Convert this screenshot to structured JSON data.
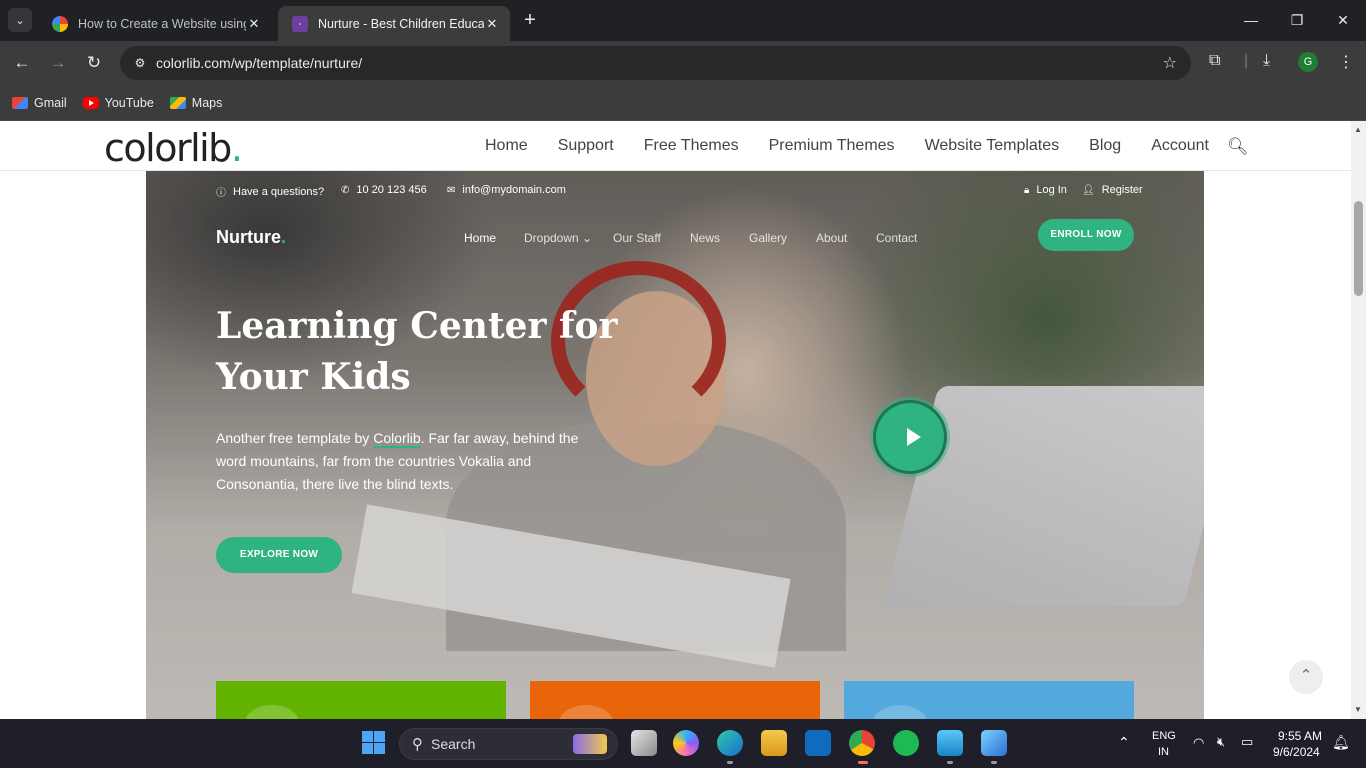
{
  "browser": {
    "tab_list_icon": "chevron-down-icon",
    "tabs": [
      {
        "title": "How to Create a Website using",
        "favicon": "google-icon"
      },
      {
        "title": "Nurture - Best Children Educati",
        "favicon": "colorlib-icon"
      }
    ],
    "new_tab": "+",
    "window": {
      "minimize": "—",
      "maximize": "❐",
      "close": "✕"
    },
    "url": "colorlib.com/wp/template/nurture/",
    "bookmarks": [
      {
        "label": "Gmail",
        "icon": "gmail-icon"
      },
      {
        "label": "YouTube",
        "icon": "youtube-icon"
      },
      {
        "label": "Maps",
        "icon": "maps-icon"
      }
    ],
    "profile_initial": "G"
  },
  "site": {
    "logo": "colorlib",
    "logo_dot": ".",
    "nav": [
      "Home",
      "Support",
      "Free Themes",
      "Premium Themes",
      "Website Templates",
      "Blog",
      "Account"
    ]
  },
  "template": {
    "topbar": {
      "question": "Have a questions?",
      "phone": "10 20 123 456",
      "email": "info@mydomain.com",
      "login": "Log In",
      "register": "Register"
    },
    "brand": "Nurture",
    "brand_dot": ".",
    "nav": [
      "Home",
      "Dropdown",
      "Our Staff",
      "News",
      "Gallery",
      "About",
      "Contact"
    ],
    "active_nav": "Home",
    "enroll": "ENROLL NOW",
    "headline": "Learning Center for Your Kids",
    "description_before": "Another free template by ",
    "description_link": "Colorlib",
    "description_after": ". Far far away, behind the word mountains, far from the countries Vokalia and Consonantia, there live the blind texts.",
    "explore": "EXPLORE NOW",
    "cards": [
      {
        "color": "#62b400"
      },
      {
        "color": "#e8650a"
      },
      {
        "color": "#53a9dd"
      }
    ]
  },
  "colors": {
    "accent": "#2fb380"
  },
  "taskbar": {
    "search_placeholder": "Search",
    "language": "ENG",
    "region": "IN",
    "time": "9:55 AM",
    "date": "9/6/2024"
  }
}
